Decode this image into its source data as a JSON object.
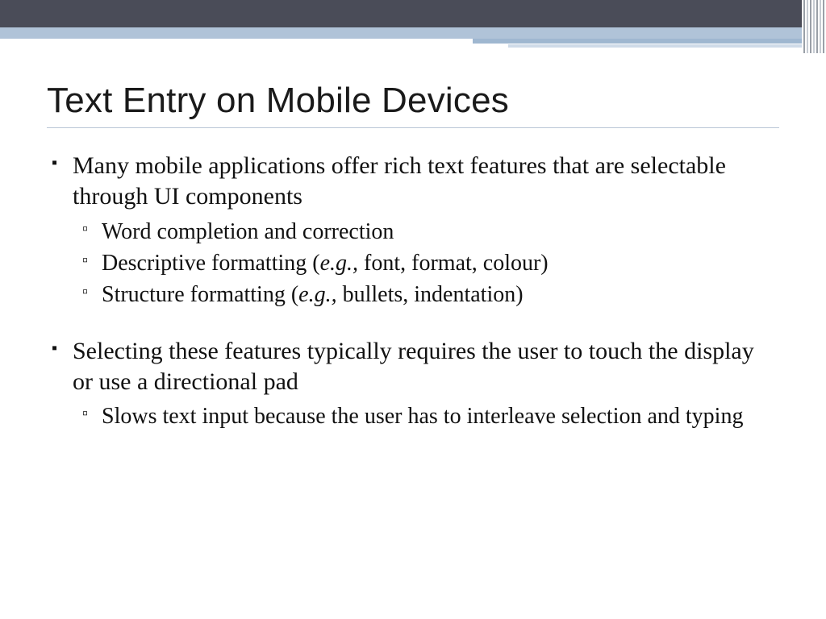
{
  "title": "Text Entry on Mobile Devices",
  "bullets": [
    {
      "text": "Many mobile applications offer rich text features that are selectable through UI components",
      "sub": [
        {
          "text": "Word completion and correction"
        },
        {
          "prefix": "Descriptive formatting (",
          "eg": "e.g.,",
          "suffix": " font, format, colour)"
        },
        {
          "prefix": "Structure formatting (",
          "eg": "e.g.,",
          "suffix": " bullets, indentation)"
        }
      ]
    },
    {
      "text": "Selecting these features typically requires the user to touch the display or use a directional pad",
      "sub": [
        {
          "text": "Slows text input because the user has to interleave selection and typing"
        }
      ]
    }
  ]
}
